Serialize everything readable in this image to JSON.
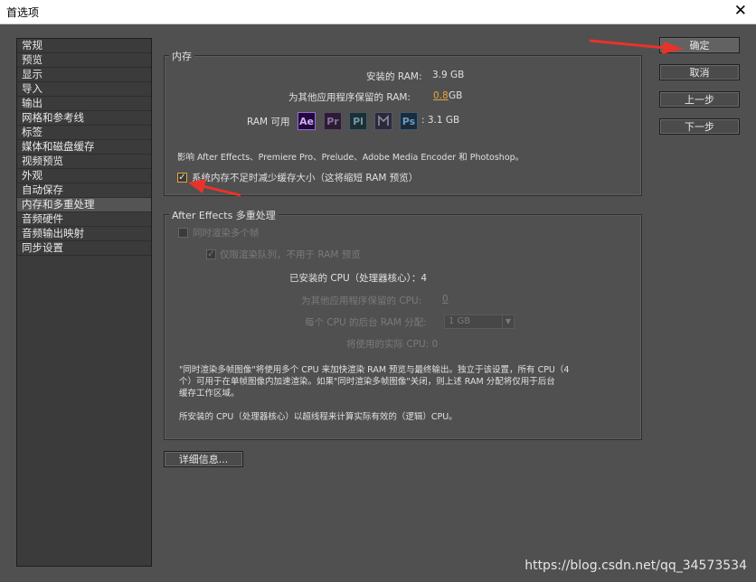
{
  "window": {
    "title": "首选项",
    "close_icon": "✕"
  },
  "sidebar": {
    "items": [
      "常规",
      "预览",
      "显示",
      "导入",
      "输出",
      "网格和参考线",
      "标签",
      "媒体和磁盘缓存",
      "视频预览",
      "外观",
      "自动保存",
      "内存和多重处理",
      "音频硬件",
      "音频输出映射",
      "同步设置"
    ],
    "selected": "内存和多重处理"
  },
  "memory": {
    "title": "内存",
    "installed_label": "安装的 RAM:",
    "installed_value": "3.9 GB",
    "reserved_label": "为其他应用程序保留的 RAM:",
    "reserved_value": "0.8",
    "reserved_unit": "GB",
    "available_label": "RAM 可用",
    "apps": [
      "Ae",
      "Pr",
      "Pl",
      "Me",
      "Ps"
    ],
    "available_value": ": 3.1 GB",
    "affects_text": "影响 After Effects、Premiere Pro、Prelude、Adobe Media Encoder 和 Photoshop。",
    "reduce_cache_label": "系统内存不足时减少缓存大小（这将缩短 RAM 预览）",
    "reduce_cache_checked": true
  },
  "mp": {
    "title": "After Effects 多重处理",
    "render_multi_label": "同时渲染多个帧",
    "queue_only_label": "仅限渲染队列，不用于 RAM 预览",
    "installed_cpu_label": "已安装的 CPU（处理器核心）：4",
    "reserved_cpu_label": "为其他应用程序保留的 CPU:",
    "reserved_cpu_value": "0",
    "ram_per_cpu_label": "每个 CPU 的后台 RAM 分配:",
    "ram_per_cpu_value": "1 GB",
    "actual_cpu_label": "将使用的实际 CPU: 0",
    "desc1_line1": "\"同时渲染多帧图像\"将使用多个 CPU 来加快渲染 RAM 预览与最终输出。独立于该设置，所有 CPU（4",
    "desc1_line2": "个）可用于在单帧图像内加速渲染。如果\"同时渲染多帧图像\"关闭，则上述 RAM 分配将仅用于后台",
    "desc1_line3": "缓存工作区域。",
    "desc2": "所安装的 CPU（处理器核心）以超线程来计算实际有效的（逻辑）CPU。"
  },
  "buttons": {
    "ok": "确定",
    "cancel": "取消",
    "prev": "上一步",
    "next": "下一步",
    "details": "详细信息..."
  },
  "watermark": "https://blog.csdn.net/qq_34573534",
  "colors": {
    "accent": "#e4a43a",
    "arrow": "#e8332a",
    "dialog_bg": "#505050"
  }
}
